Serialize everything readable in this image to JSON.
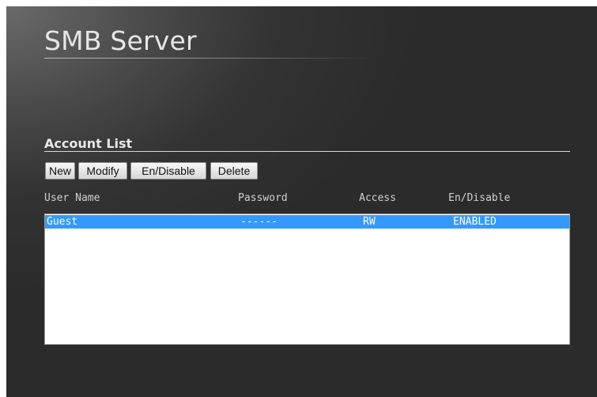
{
  "page": {
    "title": "SMB Server"
  },
  "account_list": {
    "heading": "Account List",
    "buttons": {
      "new": "New",
      "modify": "Modify",
      "endisable": "En/Disable",
      "delete": "Delete"
    },
    "columns": {
      "user": "User Name",
      "password": "Password",
      "access": "Access",
      "status": "En/Disable"
    },
    "rows": [
      {
        "user": "Guest",
        "password": "------",
        "access": "RW",
        "status": "ENABLED",
        "selected": true
      }
    ]
  },
  "colors": {
    "selection": "#3399ff",
    "background_dark": "#2b2b2b",
    "text_light": "#e6e6e6"
  }
}
